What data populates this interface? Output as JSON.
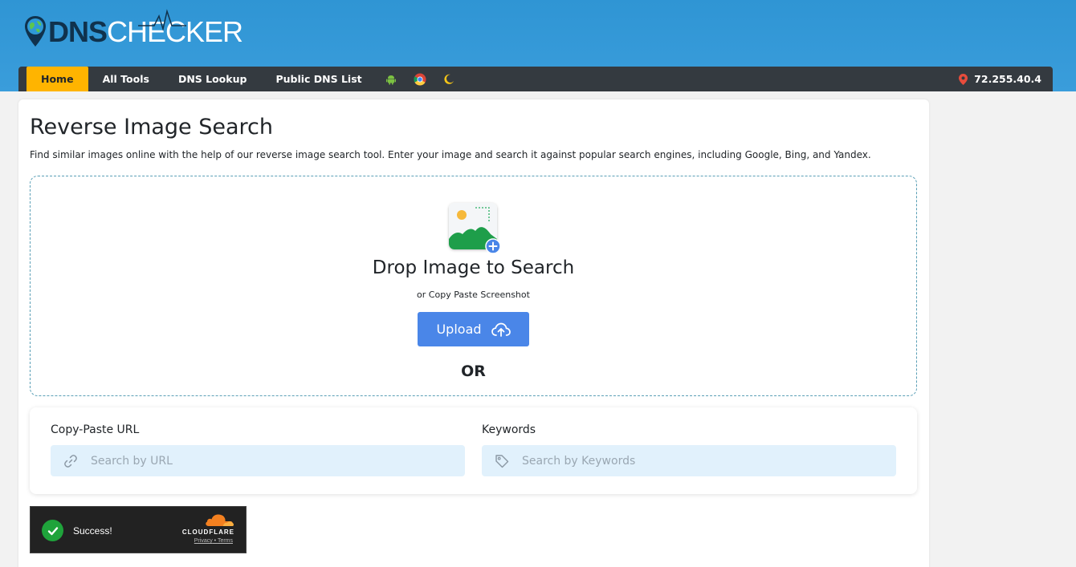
{
  "header": {
    "logo_dns": "DNS",
    "logo_checker": "CHECKER"
  },
  "nav": {
    "items": [
      {
        "label": "Home",
        "active": true
      },
      {
        "label": "All Tools"
      },
      {
        "label": "DNS Lookup"
      },
      {
        "label": "Public DNS List"
      }
    ],
    "icons": [
      "android-icon",
      "chrome-icon",
      "moon-icon"
    ],
    "ip": "72.255.40.4"
  },
  "main": {
    "title": "Reverse Image Search",
    "description": "Find similar images online with the help of our reverse image search tool. Enter your image and search it against popular search engines, including Google, Bing, and Yandex.",
    "drop_title": "Drop Image to Search",
    "drop_sub": "or Copy Paste Screenshot",
    "upload_label": "Upload",
    "or_text": "OR"
  },
  "search": {
    "url_label": "Copy-Paste URL",
    "url_placeholder": "Search by URL",
    "keywords_label": "Keywords",
    "keywords_placeholder": "Search by Keywords"
  },
  "cloudflare": {
    "status": "Success!",
    "brand": "CLOUDFLARE",
    "privacy": "Privacy",
    "separator": " • ",
    "terms": "Terms"
  },
  "colors": {
    "header": "#3498db",
    "nav_bg": "#343a40",
    "active_tab": "#ffb400",
    "upload_button": "#4a86e8",
    "field_bg": "#e1f1fc"
  }
}
